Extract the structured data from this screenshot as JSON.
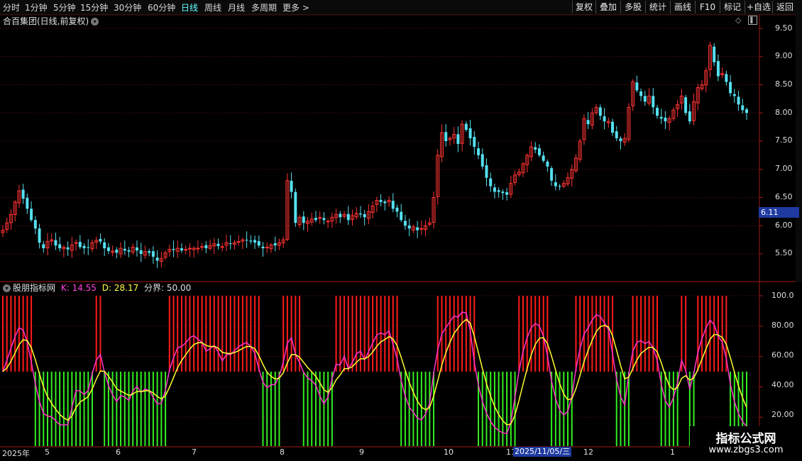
{
  "toolbar": {
    "periods": [
      "分时",
      "1分钟",
      "5分钟",
      "15分钟",
      "30分钟",
      "60分钟",
      "日线",
      "周线",
      "月线",
      "多周期",
      "更多 >"
    ],
    "active_period": "日线",
    "right_buttons": [
      "复权",
      "叠加",
      "多股",
      "统计",
      "画线",
      "F10",
      "标记",
      "+自选",
      "返回"
    ]
  },
  "main_chart": {
    "title": "合百集团(日线,前复权)",
    "price_labels": [
      "9.50",
      "9.00",
      "8.50",
      "8.00",
      "7.50",
      "7.00",
      "6.50",
      "6.00",
      "5.50"
    ],
    "current_price": "6.11"
  },
  "indicator": {
    "name": "股朋指标网",
    "k_label": "K: 14.55",
    "d_label": "D: 28.17",
    "boundary_label": "分界: 50.00",
    "axis_labels": [
      "100.0",
      "80.00",
      "60.00",
      "40.00",
      "20.00"
    ]
  },
  "date_axis": {
    "labels": [
      "2025年",
      "5",
      "6",
      "7",
      "8",
      "9",
      "10",
      "11",
      "12",
      "1"
    ],
    "cursor": "2025/11/05/三"
  },
  "watermark": {
    "title": "指标公式网",
    "url": "www.zbgs3.com"
  },
  "colors": {
    "up": "#ff3333",
    "down": "#55e0f0",
    "k_line": "#ff33cc",
    "d_line": "#ffff33",
    "bar_up": "#ff1a1a",
    "bar_down": "#33ee22"
  },
  "chart_data": {
    "type": "candlestick",
    "price_axis": {
      "min": 5.25,
      "max": 9.6,
      "ticks": [
        9.5,
        9.0,
        8.5,
        8.0,
        7.5,
        7.0,
        6.5,
        6.0,
        5.5
      ]
    },
    "closes": [
      5.92,
      6.05,
      6.2,
      6.42,
      6.62,
      6.48,
      6.3,
      6.1,
      5.95,
      5.7,
      5.6,
      5.72,
      5.75,
      5.65,
      5.6,
      5.62,
      5.58,
      5.66,
      5.7,
      5.62,
      5.6,
      5.62,
      5.7,
      5.74,
      5.72,
      5.6,
      5.55,
      5.55,
      5.52,
      5.6,
      5.56,
      5.54,
      5.62,
      5.56,
      5.5,
      5.54,
      5.52,
      5.45,
      5.38,
      5.42,
      5.52,
      5.58,
      5.57,
      5.6,
      5.56,
      5.58,
      5.6,
      5.6,
      5.6,
      5.63,
      5.6,
      5.65,
      5.68,
      5.64,
      5.63,
      5.7,
      5.68,
      5.7,
      5.72,
      5.75,
      5.75,
      5.72,
      5.7,
      5.65,
      5.6,
      5.62,
      5.66,
      5.65,
      5.7,
      5.75,
      6.8,
      6.6,
      6.05,
      6.15,
      6.05,
      6.08,
      6.12,
      6.1,
      6.15,
      6.1,
      6.08,
      6.15,
      6.2,
      6.15,
      6.2,
      6.1,
      6.18,
      6.22,
      6.2,
      6.15,
      6.25,
      6.35,
      6.45,
      6.42,
      6.4,
      6.45,
      6.3,
      6.25,
      6.1,
      6.0,
      5.95,
      5.98,
      5.92,
      5.95,
      6.0,
      6.05,
      6.5,
      7.25,
      7.65,
      7.5,
      7.55,
      7.62,
      7.45,
      7.8,
      7.7,
      7.55,
      7.4,
      7.25,
      7.05,
      6.85,
      6.7,
      6.6,
      6.6,
      6.58,
      6.55,
      6.75,
      6.9,
      6.95,
      7.1,
      7.25,
      7.4,
      7.35,
      7.25,
      7.15,
      7.05,
      6.8,
      6.7,
      6.7,
      6.75,
      6.85,
      7.0,
      7.2,
      7.5,
      7.9,
      7.8,
      8.0,
      8.1,
      7.95,
      7.85,
      7.85,
      7.65,
      7.55,
      7.5,
      7.55,
      8.1,
      8.55,
      8.4,
      8.3,
      8.2,
      8.3,
      8.1,
      7.95,
      7.9,
      7.85,
      7.9,
      8.05,
      8.15,
      8.3,
      8.0,
      7.85,
      8.2,
      8.45,
      8.5,
      8.75,
      9.2,
      8.9,
      8.65,
      8.7,
      8.55,
      8.35,
      8.3,
      8.15,
      8.05,
      8.0
    ]
  }
}
